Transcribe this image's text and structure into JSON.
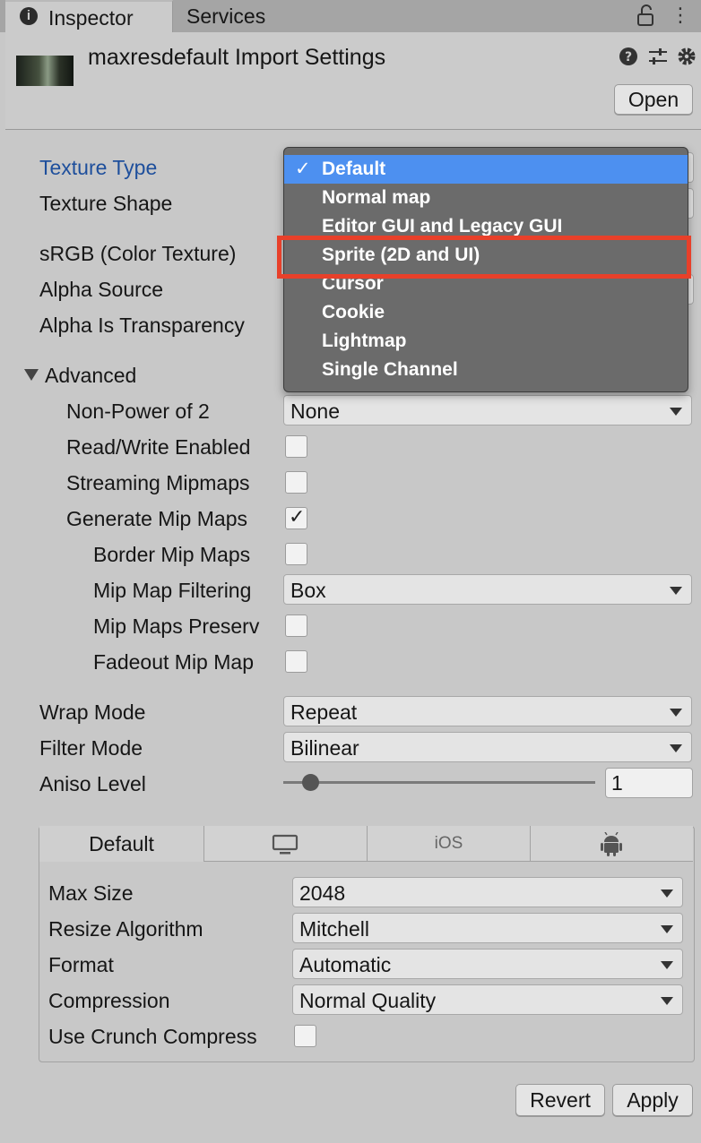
{
  "tabs": {
    "inspector": "Inspector",
    "services": "Services"
  },
  "header": {
    "title": "maxresdefault Import Settings",
    "open_label": "Open"
  },
  "icons": {
    "info": "info-icon",
    "lock": "lock-icon",
    "menu": "kebab-menu-icon",
    "help": "help-icon",
    "presets": "sliders-icon",
    "settings": "gear-icon"
  },
  "fields": {
    "texture_type": "Texture Type",
    "texture_shape": "Texture Shape",
    "srgb": "sRGB (Color Texture)",
    "alpha_source": "Alpha Source",
    "alpha_transparency": "Alpha Is Transparency",
    "advanced": "Advanced",
    "npot": "Non-Power of 2",
    "npot_value": "None",
    "read_write": "Read/Write Enabled",
    "streaming_mip": "Streaming Mipmaps",
    "gen_mip": "Generate Mip Maps",
    "border_mip": "Border Mip Maps",
    "mip_filter": "Mip Map Filtering",
    "mip_filter_value": "Box",
    "mip_preserve": "Mip Maps Preserv",
    "fadeout": "Fadeout Mip Map",
    "wrap_mode": "Wrap Mode",
    "wrap_value": "Repeat",
    "filter_mode": "Filter Mode",
    "filter_value": "Bilinear",
    "aniso": "Aniso Level",
    "aniso_value": "1"
  },
  "dropdown_options": [
    "Default",
    "Normal map",
    "Editor GUI and Legacy GUI",
    "Sprite (2D and UI)",
    "Cursor",
    "Cookie",
    "Lightmap",
    "Single Channel"
  ],
  "dropdown_selected": "Default",
  "dropdown_check": "✓",
  "platform": {
    "tabs": [
      "Default",
      "desktop-icon",
      "iOS",
      "android-icon"
    ],
    "default_label": "Default",
    "ios_label": "iOS",
    "max_size": "Max Size",
    "max_size_value": "2048",
    "resize": "Resize Algorithm",
    "resize_value": "Mitchell",
    "format": "Format",
    "format_value": "Automatic",
    "compression": "Compression",
    "compression_value": "Normal Quality",
    "crunch": "Use Crunch Compress"
  },
  "footer": {
    "revert": "Revert",
    "apply": "Apply"
  },
  "colors": {
    "selection": "#4d90f0",
    "highlight_box": "#e8402a",
    "label_active": "#1e4f9c"
  }
}
